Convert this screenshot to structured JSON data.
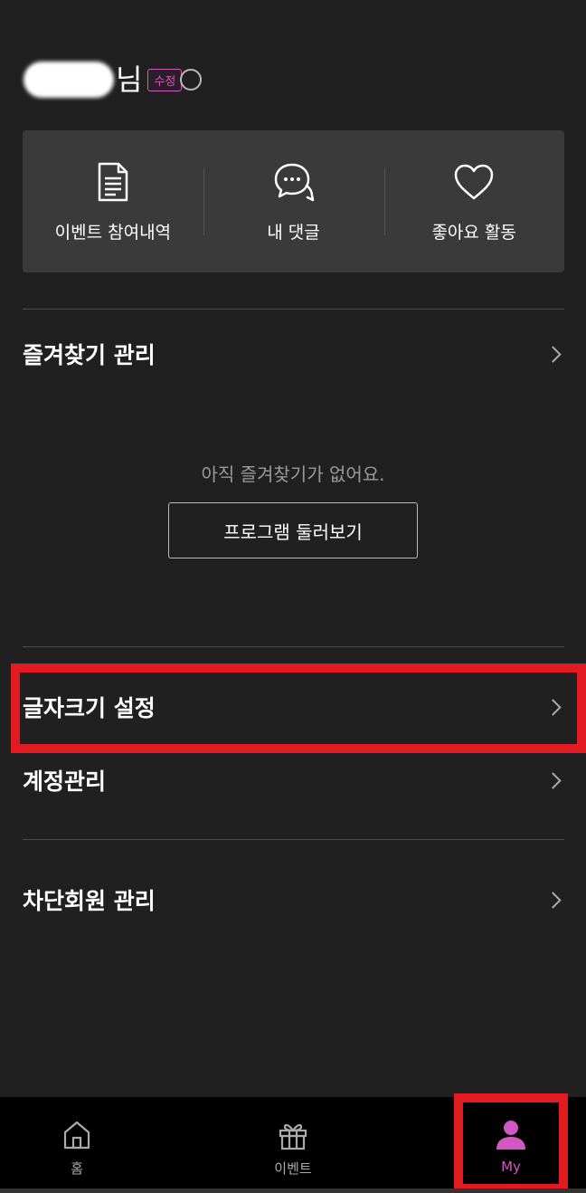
{
  "profile": {
    "name_suffix": "님",
    "edit_label": "수정"
  },
  "activity": {
    "items": [
      {
        "label": "이벤트 참여내역",
        "icon": "document-icon"
      },
      {
        "label": "내 댓글",
        "icon": "comment-icon"
      },
      {
        "label": "좋아요 활동",
        "icon": "heart-icon"
      }
    ]
  },
  "favorites": {
    "title": "즐겨찾기 관리",
    "empty_message": "아직 즐겨찾기가 없어요.",
    "browse_button": "프로그램 둘러보기"
  },
  "settings": {
    "font_size": "글자크기 설정",
    "account": "계정관리",
    "blocked": "차단회원 관리"
  },
  "bottom_nav": {
    "items": [
      {
        "label": "홈",
        "icon": "home-icon"
      },
      {
        "label": "이벤트",
        "icon": "gift-icon"
      },
      {
        "label": "My",
        "icon": "person-icon",
        "active": true
      }
    ]
  },
  "colors": {
    "background": "#202020",
    "accent": "#d357c3",
    "highlight": "#e21b23"
  }
}
